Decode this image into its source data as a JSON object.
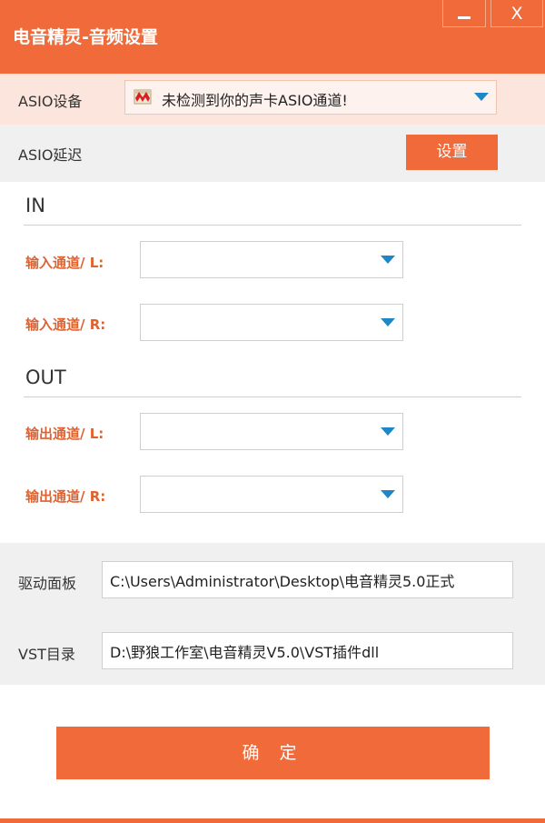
{
  "window": {
    "title": "电音精灵-音频设置",
    "minimize_label": "—",
    "close_label": "X"
  },
  "asio": {
    "device_label": "ASIO设备",
    "device_value": "未检测到你的声卡ASIO通道!",
    "delay_label": "ASIO延迟",
    "settings_button": "设置"
  },
  "in_section": {
    "title": "IN",
    "left_label": "输入通道/ L:",
    "right_label": "输入通道/ R:"
  },
  "out_section": {
    "title": "OUT",
    "left_label": "输出通道/ L:",
    "right_label": "输出通道/ R:"
  },
  "paths": {
    "driver_label": "驱动面板",
    "driver_value": "C:\\Users\\Administrator\\Desktop\\电音精灵5.0正式",
    "vst_label": "VST目录",
    "vst_value": "D:\\野狼工作室\\电音精灵V5.0\\VST插件dll"
  },
  "confirm_button": "确 定",
  "colors": {
    "accent": "#f06a3a",
    "label_accent": "#e0622f",
    "dropdown_arrow": "#1f86c8"
  }
}
